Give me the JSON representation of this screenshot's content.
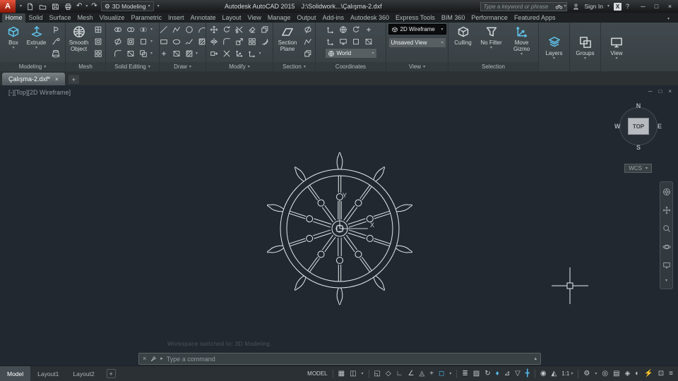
{
  "titlebar": {
    "logo": "A",
    "workspace": "3D Modeling",
    "app_title": "Autodesk AutoCAD 2015",
    "doc_path": "J:\\Solidwork...\\Çalışma-2.dxf",
    "search_placeholder": "Type a keyword or phrase",
    "sign_in": "Sign In"
  },
  "tabs": [
    "Home",
    "Solid",
    "Surface",
    "Mesh",
    "Visualize",
    "Parametric",
    "Insert",
    "Annotate",
    "Layout",
    "View",
    "Manage",
    "Output",
    "Add-ins",
    "Autodesk 360",
    "Express Tools",
    "BIM 360",
    "Performance",
    "Featured Apps"
  ],
  "ribbon": {
    "modeling": {
      "label": "Modeling",
      "box": "Box",
      "extrude": "Extrude"
    },
    "mesh": {
      "label": "Mesh",
      "smooth_object": "Smooth Object"
    },
    "solid_editing": {
      "label": "Solid Editing"
    },
    "draw": {
      "label": "Draw"
    },
    "modify": {
      "label": "Modify"
    },
    "section": {
      "label": "Section",
      "section_plane": "Section Plane"
    },
    "coordinates": {
      "label": "Coordinates",
      "ucs": "World"
    },
    "view": {
      "label": "View",
      "visual_style": "2D Wireframe",
      "named_view": "Unsaved View"
    },
    "selection": {
      "label": "Selection",
      "culling": "Culling",
      "filter": "No Filter",
      "gizmo": "Move Gizmo"
    },
    "layers": {
      "label": "Layers"
    },
    "groups": {
      "label": "Groups"
    },
    "view_tools": {
      "label": "View"
    }
  },
  "doc_tab": "Çalışma-2.dxf*",
  "viewport": {
    "label": "[-][Top][2D Wireframe]",
    "axis_x": "X",
    "axis_y": "Y",
    "viewcube": {
      "n": "N",
      "e": "E",
      "s": "S",
      "w": "W",
      "face": "TOP",
      "wcs": "WCS"
    }
  },
  "command": {
    "history": "Workspace switched to: 3D Modeling.",
    "placeholder": "Type a command"
  },
  "layout_tabs": [
    "Model",
    "Layout1",
    "Layout2"
  ],
  "statusbar": {
    "space": "MODEL",
    "scale": "1:1"
  },
  "colors": {
    "viewport_bg": "#212830",
    "ribbon_bg": "#3b4347",
    "accent_teal": "#5fc0e8",
    "line": "#e4e8ea"
  },
  "icons": {
    "undo": "↶",
    "redo": "↷",
    "caret": "▾",
    "up": "▴",
    "prompt_arrow": "▸",
    "close": "×",
    "minimize": "─",
    "restore": "□",
    "help": "?",
    "exchange": "X",
    "plus": "+",
    "workspace_gear": "⚙",
    "grid": "▦",
    "snap": "◫",
    "infer": "◱",
    "dyn_input": "◇",
    "ortho": "∟",
    "polar": "∠",
    "isodraft": "◬",
    "otrack": "+",
    "osnap": "◻",
    "lineweight": "≣",
    "transparency": "▨",
    "cycling": "↻",
    "osnap3d": "♦",
    "dynucs": "⊿",
    "filter": "▽",
    "gizmo": "╋",
    "annovis": "◉",
    "autoscale": "◭",
    "monitor": "◎",
    "quickprop": "▤",
    "lockui": "◈",
    "isolate": "◐",
    "perf": "⚡",
    "clean": "⊡",
    "customize": "≡"
  }
}
